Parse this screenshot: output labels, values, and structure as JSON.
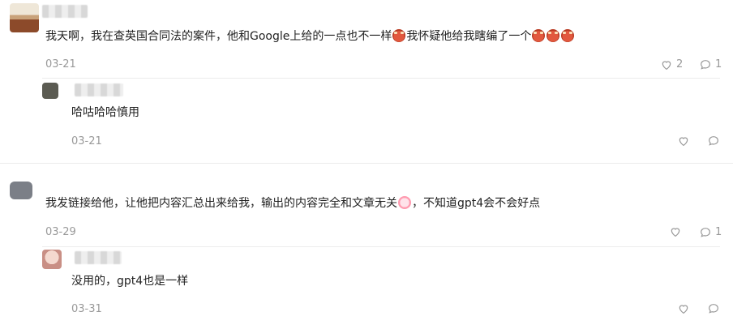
{
  "comments": [
    {
      "text_before": "我天啊，我在查英国合同法的案件，他和Google上给的一点也不一样",
      "text_middle": "我怀疑他给我瞎编了一个",
      "date": "03-21",
      "likes": "2",
      "replies": "1",
      "reply": {
        "text": "哈咕哈哈慎用",
        "date": "03-21"
      }
    },
    {
      "text_before": "我发链接给他，让他把内容汇总出来给我，输出的内容完全和文章无关",
      "text_after": "，不知道gpt4会不会好点",
      "date": "03-29",
      "likes": "",
      "replies": "1",
      "reply": {
        "text": "没用的，gpt4也是一样",
        "date": "03-31"
      }
    }
  ],
  "colors": {
    "meta_text": "#999999",
    "body_text": "#222222",
    "divider": "#ececec"
  },
  "icons": {
    "like": "heart-icon",
    "reply": "comment-bubble-icon"
  }
}
